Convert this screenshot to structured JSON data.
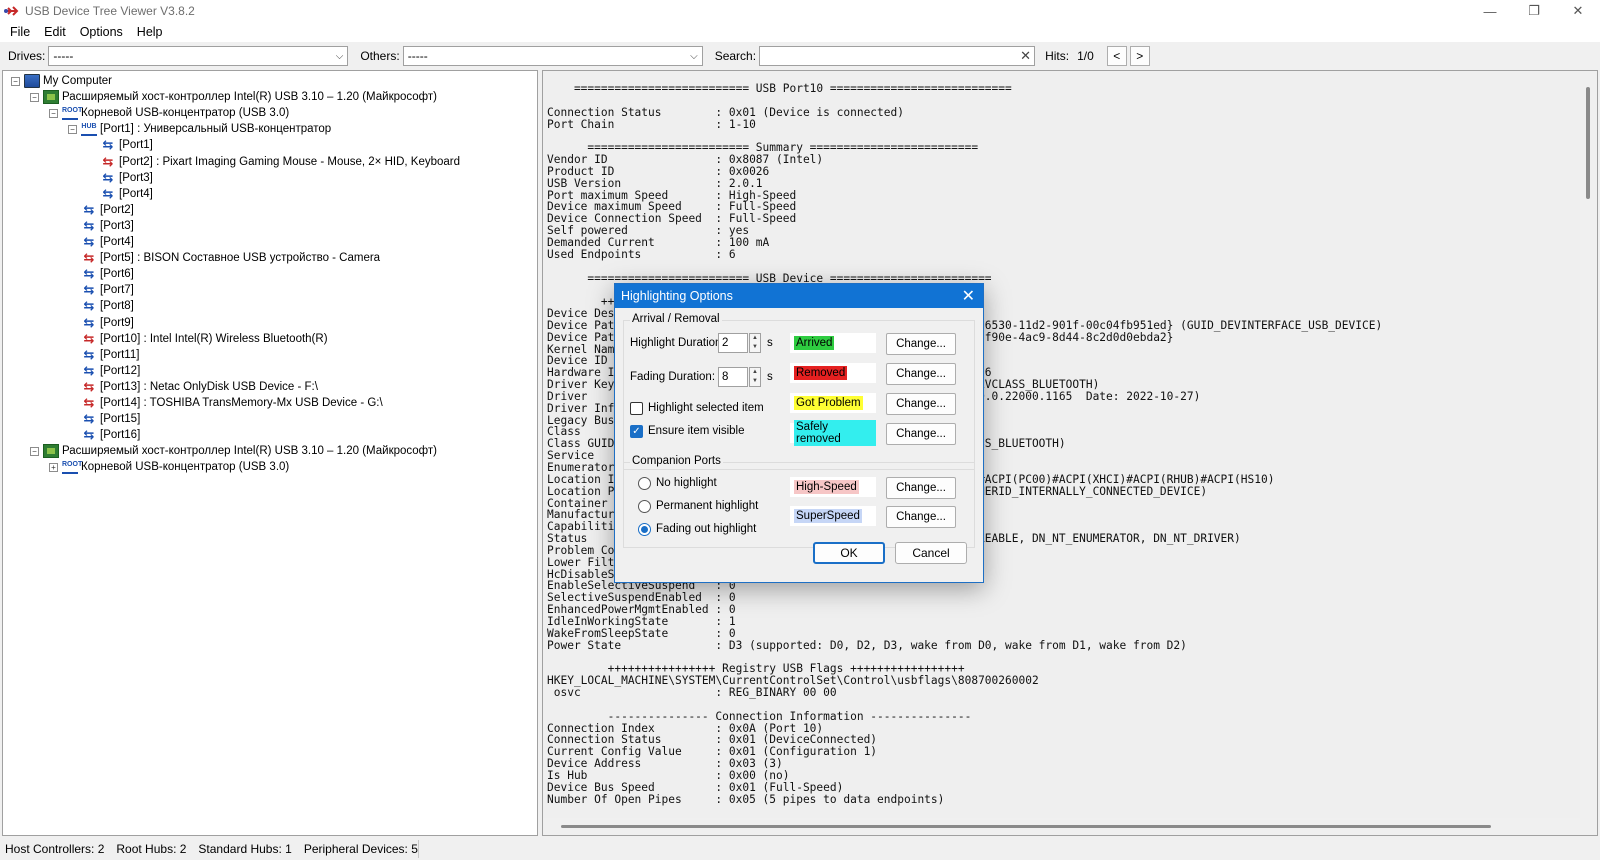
{
  "window": {
    "title": "USB Device Tree Viewer V3.8.2",
    "minimize": "—",
    "restore": "❐",
    "close": "✕"
  },
  "menu": [
    "File",
    "Edit",
    "Options",
    "Help"
  ],
  "toolbar": {
    "drives_label": "Drives:",
    "drives_value": "-----",
    "others_label": "Others:",
    "others_value": "-----",
    "search_label": "Search:",
    "search_value": "",
    "hits_label": "Hits:",
    "hits_value": "1/0",
    "prev": "<",
    "next": ">"
  },
  "tree": [
    {
      "text": "My Computer",
      "icon": "computer-icon",
      "expander": "−"
    },
    {
      "text": "Расширяемый хост-контроллер Intel(R) USB 3.10 – 1.20 (Майкрософт)",
      "icon": "host-controller-icon",
      "expander": "−"
    },
    {
      "text": "Корневой USB-концентратор (USB 3.0)",
      "icon": "root-hub-icon",
      "expander": "−"
    },
    {
      "text": "[Port1] : Универсальный USB-концентратор",
      "icon": "hub-icon",
      "expander": "−"
    },
    {
      "text": "[Port1]",
      "icon": "usb-port-icon"
    },
    {
      "text": "[Port2] : Pixart Imaging Gaming Mouse - Mouse, 2× HID, Keyboard",
      "icon": "usb-device-icon"
    },
    {
      "text": "[Port3]",
      "icon": "usb-port-icon"
    },
    {
      "text": "[Port4]",
      "icon": "usb-port-icon"
    },
    {
      "text": "[Port2]",
      "icon": "usb-port-icon"
    },
    {
      "text": "[Port3]",
      "icon": "usb-port-icon"
    },
    {
      "text": "[Port4]",
      "icon": "usb-port-icon"
    },
    {
      "text": "[Port5] : BISON Составное USB устройство - Camera",
      "icon": "usb-device-icon"
    },
    {
      "text": "[Port6]",
      "icon": "usb-port-icon"
    },
    {
      "text": "[Port7]",
      "icon": "usb-port-icon"
    },
    {
      "text": "[Port8]",
      "icon": "usb-port-icon"
    },
    {
      "text": "[Port9]",
      "icon": "usb-port-icon"
    },
    {
      "text": "[Port10] : Intel Intel(R) Wireless Bluetooth(R)",
      "icon": "usb-device-icon"
    },
    {
      "text": "[Port11]",
      "icon": "usb-port-icon"
    },
    {
      "text": "[Port12]",
      "icon": "usb-port-icon"
    },
    {
      "text": "[Port13] : Netac OnlyDisk USB Device - F:\\",
      "icon": "usb-device-icon"
    },
    {
      "text": "[Port14] : TOSHIBA TransMemory-Mx USB Device - G:\\",
      "icon": "usb-device-icon"
    },
    {
      "text": "[Port15]",
      "icon": "usb-port-icon"
    },
    {
      "text": "[Port16]",
      "icon": "usb-port-icon"
    },
    {
      "text": "Расширяемый хост-контроллер Intel(R) USB 3.10 – 1.20 (Майкрософт)",
      "icon": "host-controller-icon",
      "expander": "−"
    },
    {
      "text": "Корневой USB-концентратор (USB 3.0)",
      "icon": "root-hub-icon",
      "expander": "+"
    }
  ],
  "detail_text": "    ========================== USB Port10 ===========================\n\nConnection Status        : 0x01 (Device is connected)\nPort Chain               : 1-10\n\n      ======================== Summary =========================\nVendor ID                : 0x8087 (Intel)\nProduct ID               : 0x0026\nUSB Version              : 2.0.1\nPort maximum Speed       : High-Speed\nDevice maximum Speed     : Full-Speed\nDevice Connection Speed  : Full-Speed\nSelf powered             : yes\nDemanded Current         : 100 mA\nUsed Endpoints           : 6\n\n      ======================== USB Device ========================\n\n        ++\nDevice Des                                      \nDevice Pat                                       &0&10#{a5dcbf10-6530-11d2-901f-00c04fb951ed} (GUID_DEVINTERFACE_USB_DEVICE)\nDevice Pat                                       &0&10#{92383b0e-f90e-4ac9-8d44-8c2d0d0ebda2}\nKernel Nam                                      \nDevice ID                                        0\nHardware I                                       VID_8087&PID_0026\nDriver Key                                       4}\\0000 (GUID_DEVCLASS_BLUETOOTH)\nDriver                                           sys (Version: 10.0.22000.1165  Date: 2022-10-27)\nDriver Inf                                      \nLegacy Bus                                      \nClass                                           \nClass GUID                                       4} (GUID_DEVCLASS_BLUETOOTH)\nService                                         \nEnumerator                                      \nLocation I                                       10), ACPI(_SB_)#ACPI(PC00)#ACPI(XHCI)#ACPI(RHUB)#ACPI(HS10)\nLocation P                                       f} (GUID_CONTAINERID_INTERNALLY_CONNECTED_DEVICE)\nContainer                                       \nManufactur                                      \nCapabiliti                                      \nStatus                                           ARTED, DN_DISABLEABLE, DN_NT_ENUMERATOR, DN_NT_DRIVER)\nProblem Co                                      \nLower Filt                                      \nHcDisableS                                      \nEnableSelectiveSuspend   : 0\nSelectiveSuspendEnabled  : 0\nEnhancedPowerMgmtEnabled : 0\nIdleInWorkingState       : 1\nWakeFromSleepState       : 0\nPower State              : D3 (supported: D0, D2, D3, wake from D0, wake from D1, wake from D2)\n\n         ++++++++++++++++ Registry USB Flags +++++++++++++++++\nHKEY_LOCAL_MACHINE\\SYSTEM\\CurrentControlSet\\Control\\usbflags\\808700260002\n osvc                    : REG_BINARY 00 00\n\n         --------------- Connection Information ---------------\nConnection Index         : 0x0A (Port 10)\nConnection Status        : 0x01 (DeviceConnected)\nCurrent Config Value     : 0x01 (Configuration 1)\nDevice Address           : 0x03 (3)\nIs Hub                   : 0x00 (no)\nDevice Bus Speed         : 0x01 (Full-Speed)\nNumber Of Open Pipes     : 0x05 (5 pipes to data endpoints)",
  "status": {
    "host_controllers": "Host Controllers: 2",
    "root_hubs": "Root Hubs: 2",
    "standard_hubs": "Standard Hubs: 1",
    "peripheral_devices": "Peripheral Devices: 5"
  },
  "dialog": {
    "title": "Highlighting Options",
    "arrival_group": "Arrival / Removal",
    "highlight_duration_label": "Highlight Duration:",
    "highlight_duration_value": "2",
    "fading_duration_label": "Fading Duration:",
    "fading_duration_value": "8",
    "seconds": "s",
    "highlight_selected_label": "Highlight selected item",
    "highlight_selected_checked": false,
    "ensure_visible_label": "Ensure item visible",
    "ensure_visible_checked": true,
    "samples": [
      {
        "label": "Arrived",
        "bg": "#2ecc40",
        "fg": "#000000"
      },
      {
        "label": "Removed",
        "bg": "#e52020",
        "fg": "#000000"
      },
      {
        "label": "Got Problem",
        "bg": "#ffff33",
        "fg": "#000000"
      },
      {
        "label": "Safely removed",
        "bg": "#33eeee",
        "fg": "#000000"
      }
    ],
    "companion_group": "Companion Ports",
    "radio_no": "No highlight",
    "radio_permanent": "Permanent highlight",
    "radio_fading": "Fading out highlight",
    "selected_radio": "fading",
    "companion_samples": [
      {
        "label": "High-Speed",
        "bg": "#f6c6c6",
        "fg": "#000000"
      },
      {
        "label": "SuperSpeed",
        "bg": "#c6d6f6",
        "fg": "#000000"
      }
    ],
    "change_label": "Change...",
    "ok": "OK",
    "cancel": "Cancel"
  }
}
